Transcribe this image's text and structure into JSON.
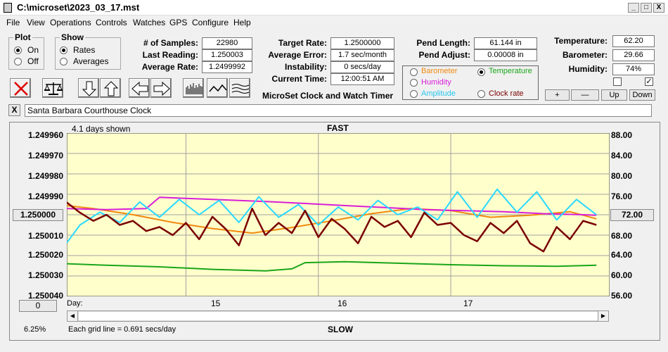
{
  "window": {
    "title": "C:\\microset\\2023_03_17.mst",
    "minimize": "_",
    "maximize": "□",
    "close": "X"
  },
  "menu": [
    "File",
    "View",
    "Operations",
    "Controls",
    "Watches",
    "GPS",
    "Configure",
    "Help"
  ],
  "plot": {
    "legend": "Plot",
    "on": "On",
    "off": "Off",
    "selected": "On"
  },
  "show": {
    "legend": "Show",
    "rates": "Rates",
    "averages": "Averages",
    "selected": "Rates"
  },
  "stats": {
    "samples_label": "# of Samples:",
    "samples": "22980",
    "last_label": "Last Reading:",
    "last": "1.250003",
    "avg_label": "Average Rate:",
    "avg": "1.2499992",
    "target_label": "Target Rate:",
    "target": "1.2500000",
    "averr_label": "Average Error:",
    "averr": "1.7 sec/month",
    "instab_label": "Instability:",
    "instab": "0 secs/day",
    "time_label": "Current Time:",
    "time": "12:00:51 AM",
    "pendlen_label": "Pend Length:",
    "pendlen": "61.144 in",
    "pendadj_label": "Pend Adjust:",
    "pendadj": "0.00008 in",
    "temp_label": "Temperature:",
    "temp": "62.20",
    "baro_label": "Barometer:",
    "baro": "29.66",
    "hum_label": "Humidity:",
    "hum": "74%"
  },
  "app_caption": "MicroSet Clock and Watch Timer",
  "env": {
    "barometer": "Barometer",
    "temperature": "Temperature",
    "humidity": "Humidity",
    "amplitude": "Amplitude",
    "clockrate": "Clock rate",
    "selected": "Temperature"
  },
  "env_buttons": {
    "plus": "+",
    "minus": "—",
    "up": "Up",
    "down": "Down"
  },
  "checkbox_right_checked": "✓",
  "clock_name": "Santa Barbara Courthouse Clock",
  "clear_btn": "X",
  "chart": {
    "days_shown": "4.1 days shown",
    "fast": "FAST",
    "slow": "SLOW",
    "grid_note": "Each grid line = 0.691 secs/day",
    "zoom": "6.25%",
    "day_label": "Day:",
    "left_offset_btn": "0",
    "left_center_btn": "1.250000",
    "right_center_btn": "72.00"
  },
  "colors": {
    "rate": "#7a0000",
    "temperature": "#1aa51a",
    "barometer": "#f08a10",
    "humidity": "#d81ed8",
    "amplitude": "#29d8ff",
    "plotbg": "#ffffcc",
    "grid": "#a0a0a0"
  },
  "chart_data": {
    "type": "line",
    "yleft_ticks": [
      "1.249960",
      "1.249970",
      "1.249980",
      "1.249990",
      "1.250000",
      "1.250010",
      "1.250020",
      "1.250030",
      "1.250040"
    ],
    "yleft_range": [
      1.24996,
      1.25004
    ],
    "yright_ticks": [
      "88.00",
      "84.00",
      "80.00",
      "76.00",
      "72.00",
      "68.00",
      "64.00",
      "60.00",
      "56.00"
    ],
    "yright_range": [
      56,
      88
    ],
    "x_ticks": [
      "15",
      "16",
      "17"
    ],
    "x_range": [
      14.1,
      18.2
    ],
    "series": [
      {
        "name": "Clock rate",
        "color": "#7a0000",
        "axis": "left",
        "x": [
          14.1,
          14.2,
          14.3,
          14.4,
          14.5,
          14.6,
          14.7,
          14.8,
          14.9,
          15.0,
          15.1,
          15.2,
          15.3,
          15.4,
          15.5,
          15.6,
          15.7,
          15.8,
          15.9,
          16.0,
          16.1,
          16.2,
          16.3,
          16.4,
          16.5,
          16.6,
          16.7,
          16.8,
          16.9,
          17.0,
          17.1,
          17.2,
          17.3,
          17.4,
          17.5,
          17.6,
          17.7,
          17.8,
          17.9,
          18.0,
          18.1
        ],
        "values": [
          1.249994,
          1.249999,
          1.250003,
          1.25,
          1.250005,
          1.250003,
          1.250008,
          1.250006,
          1.25001,
          1.250004,
          1.250012,
          1.250001,
          1.250007,
          1.250015,
          1.249997,
          1.25001,
          1.250004,
          1.250009,
          1.249998,
          1.250011,
          1.250002,
          1.250007,
          1.250014,
          1.250001,
          1.250006,
          1.250003,
          1.250011,
          1.249999,
          1.250005,
          1.250004,
          1.25001,
          1.250013,
          1.250004,
          1.250009,
          1.250003,
          1.250014,
          1.250018,
          1.250006,
          1.250012,
          1.250003,
          1.250005
        ]
      },
      {
        "name": "Temperature",
        "color": "#1aa51a",
        "axis": "right",
        "x": [
          14.1,
          14.4,
          14.8,
          15.2,
          15.6,
          15.8,
          15.9,
          16.2,
          16.6,
          17.0,
          17.4,
          17.8,
          18.1
        ],
        "values": [
          62.4,
          62.1,
          61.8,
          61.3,
          61.0,
          61.4,
          62.6,
          62.8,
          62.5,
          62.2,
          62.0,
          61.9,
          62.1
        ]
      },
      {
        "name": "Barometer",
        "color": "#f08a10",
        "axis": "right",
        "x": [
          14.1,
          14.3,
          14.6,
          14.9,
          15.2,
          15.5,
          15.8,
          16.1,
          16.4,
          16.7,
          17.0,
          17.3,
          17.6,
          17.9,
          18.1
        ],
        "values": [
          73.8,
          73.2,
          72.0,
          70.5,
          69.3,
          68.4,
          69.5,
          70.8,
          72.2,
          73.2,
          72.8,
          71.5,
          71.9,
          72.6,
          71.2
        ]
      },
      {
        "name": "Humidity",
        "color": "#d81ed8",
        "axis": "right",
        "x": [
          14.1,
          14.4,
          14.7,
          14.8,
          15.2,
          15.6,
          15.9,
          16.2,
          16.5,
          16.8,
          17.1,
          17.4,
          17.7,
          18.0,
          18.1
        ],
        "values": [
          73.2,
          73.0,
          73.2,
          75.4,
          75.0,
          74.6,
          74.2,
          73.8,
          73.4,
          73.0,
          72.8,
          72.6,
          72.2,
          72.0,
          71.9
        ]
      },
      {
        "name": "Amplitude",
        "color": "#29d8ff",
        "axis": "right",
        "x": [
          14.1,
          14.2,
          14.35,
          14.5,
          14.65,
          14.8,
          14.95,
          15.1,
          15.25,
          15.4,
          15.55,
          15.7,
          15.85,
          16.0,
          16.15,
          16.3,
          16.45,
          16.6,
          16.75,
          16.9,
          17.05,
          17.2,
          17.35,
          17.5,
          17.65,
          17.8,
          17.95,
          18.1
        ],
        "values": [
          66.5,
          70.0,
          72.5,
          70.5,
          74.5,
          71.5,
          75.0,
          72.0,
          74.8,
          70.5,
          75.5,
          71.5,
          74.0,
          70.0,
          73.5,
          71.0,
          74.8,
          72.0,
          73.5,
          71.0,
          76.5,
          71.5,
          77.0,
          72.5,
          76.5,
          71.0,
          75.0,
          72.0
        ]
      }
    ]
  }
}
